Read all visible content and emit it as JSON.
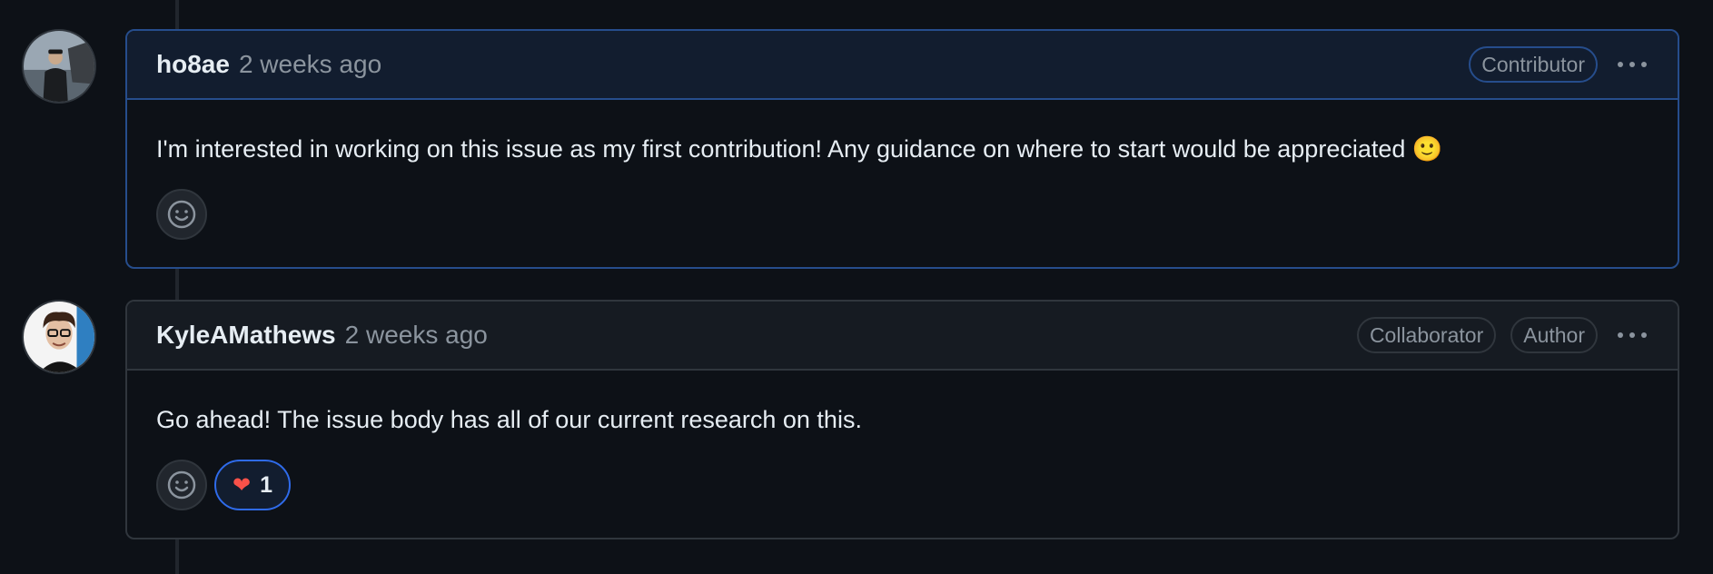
{
  "comments": [
    {
      "author": "ho8ae",
      "time": "2 weeks ago",
      "badges": [
        "Contributor"
      ],
      "body": "I'm interested in working on this issue as my first contribution! Any guidance on where to start would be appreciated 🙂",
      "reactions": []
    },
    {
      "author": "KyleAMathews",
      "time": "2 weeks ago",
      "badges": [
        "Collaborator",
        "Author"
      ],
      "body": "Go ahead! The issue body has all of our current research on this.",
      "reactions": [
        {
          "emoji": "❤",
          "icon": "heart-icon",
          "count": "1"
        }
      ]
    }
  ],
  "colors": {
    "background": "#0d1117",
    "highlight_border": "#264d8c",
    "reaction_selected_border": "#2f6bea"
  }
}
